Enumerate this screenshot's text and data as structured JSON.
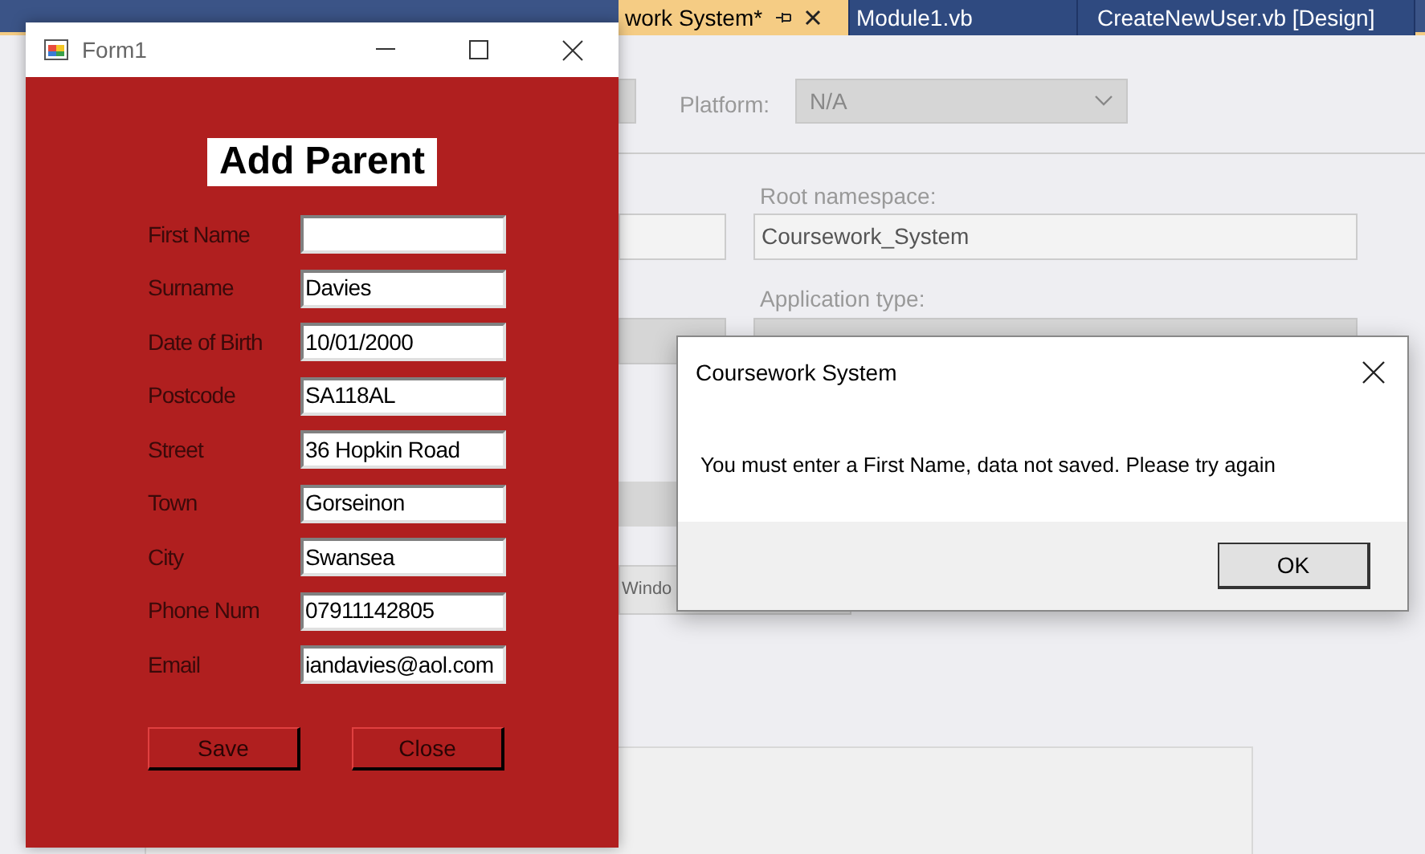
{
  "ide": {
    "tabs": [
      {
        "label": "work System*",
        "selected": true,
        "pinned": true
      },
      {
        "label": "Module1.vb",
        "selected": false,
        "pinned": false
      },
      {
        "label": "CreateNewUser.vb [Design]",
        "selected": false,
        "pinned": false
      }
    ],
    "platform": {
      "label": "Platform:",
      "value": "N/A"
    },
    "root_namespace": {
      "label": "Root namespace:",
      "value": "Coursework_System"
    },
    "application_type": {
      "label": "Application type:"
    },
    "partial_field": {
      "value": "Windo"
    }
  },
  "form": {
    "title": "Form1",
    "heading": "Add Parent",
    "fields": [
      {
        "label": "First Name"
      },
      {
        "label": "Surname",
        "value": "Davies"
      },
      {
        "label": "Date of Birth",
        "value": "10/01/2000"
      },
      {
        "label": "Postcode",
        "value": "SA118AL"
      },
      {
        "label": "Street",
        "value": "36 Hopkin Road"
      },
      {
        "label": "Town",
        "value": "Gorseinon"
      },
      {
        "label": "City",
        "value": "Swansea"
      },
      {
        "label": "Phone Num",
        "value": "07911142805"
      },
      {
        "label": "Email",
        "value": "iandavies@aol.com"
      }
    ],
    "buttons": [
      "Save",
      "Close"
    ]
  },
  "dialog": {
    "title": "Coursework System",
    "message": "You must enter a First Name, data not saved. Please try again",
    "buttons": [
      "OK"
    ]
  }
}
